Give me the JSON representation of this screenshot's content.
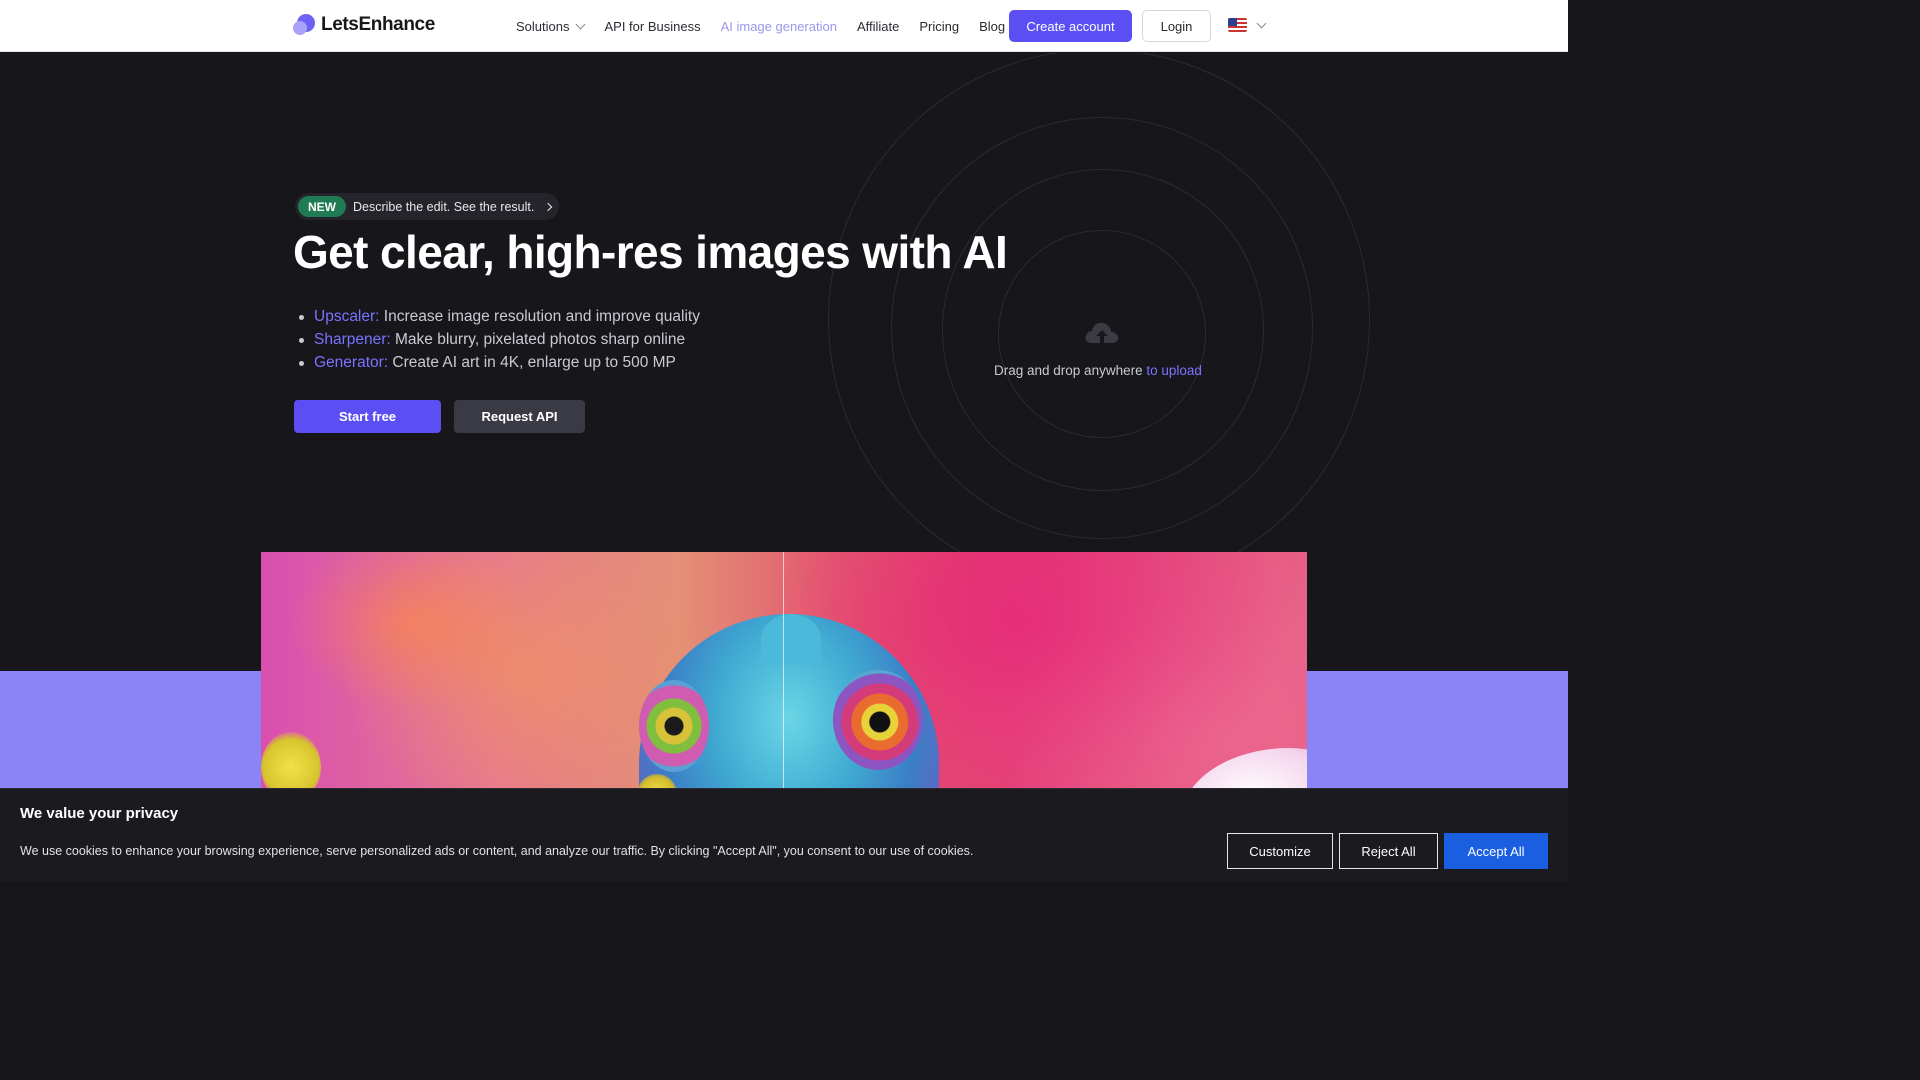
{
  "header": {
    "logo_text": "LetsEnhance",
    "nav": [
      {
        "label": "Solutions",
        "has_dropdown": true
      },
      {
        "label": "API for Business"
      },
      {
        "label": "AI image generation",
        "active": true
      },
      {
        "label": "Affiliate"
      },
      {
        "label": "Pricing"
      },
      {
        "label": "Blog"
      }
    ],
    "create_account_label": "Create account",
    "login_label": "Login",
    "language_icon": "us-flag-icon"
  },
  "hero": {
    "badge": "NEW",
    "badge_text": "Describe the edit. See the result.",
    "title": "Get clear, high-res images with AI",
    "features": [
      {
        "name": "Upscaler:",
        "text": "Increase image resolution and improve quality"
      },
      {
        "name": "Sharpener:",
        "text": "Make blurry, pixelated photos sharp online"
      },
      {
        "name": "Generator:",
        "text": "Create AI art in 4K, enlarge up to 500 MP"
      }
    ],
    "start_free_label": "Start free",
    "request_api_label": "Request API",
    "drop_text": "Drag and drop anywhere",
    "drop_link": "to upload"
  },
  "cookie": {
    "title": "We value your privacy",
    "text": "We use cookies to enhance your browsing experience, serve personalized ads or content, and analyze our traffic. By clicking \"Accept All\", you consent to our use of cookies.",
    "customize_label": "Customize",
    "reject_label": "Reject All",
    "accept_label": "Accept All"
  },
  "colors": {
    "accent": "#5b4ff3",
    "link": "#7b72ff",
    "new_badge": "#1e7b54",
    "band": "#8b84f7",
    "accept_button": "#1a5fe0"
  }
}
